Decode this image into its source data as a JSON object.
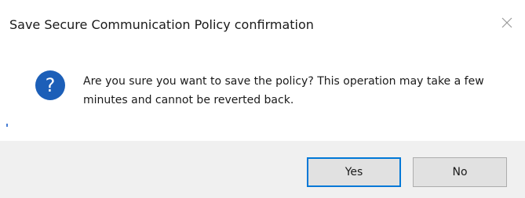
{
  "dialog": {
    "title": "Save Secure Communication Policy confirmation",
    "close_icon": "close-icon",
    "message_icon": "question-icon",
    "message_icon_glyph": "?",
    "message": "Are you sure you want to save the policy? This operation may take a few minutes and cannot be reverted back.",
    "buttons": {
      "yes_label": "Yes",
      "no_label": "No"
    }
  },
  "colors": {
    "icon_blue": "#1c5fb8",
    "footer_bg": "#f0f0f0",
    "default_button_border": "#0078d7"
  }
}
